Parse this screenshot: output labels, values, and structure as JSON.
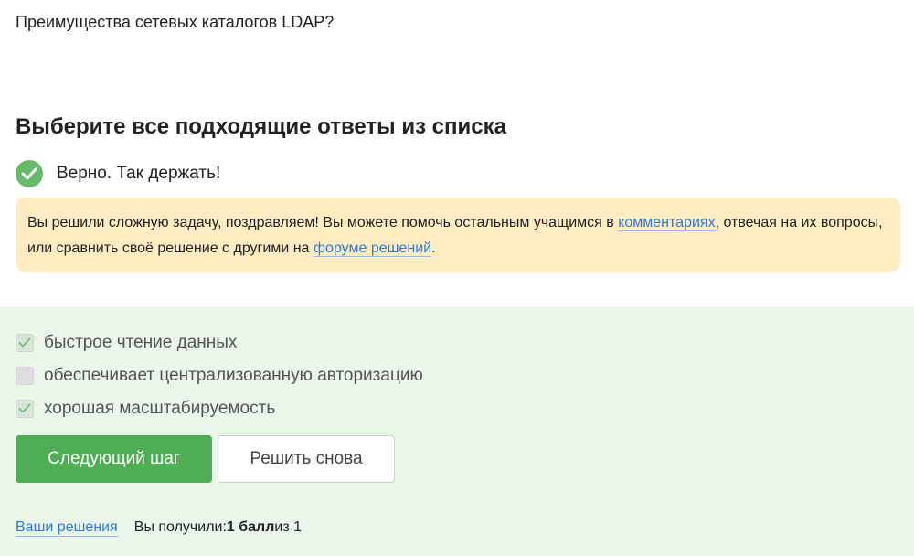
{
  "question": {
    "text": "Преимущества сетевых каталогов LDAP?"
  },
  "instruction": {
    "text": "Выберите все подходящие ответы из списка"
  },
  "status": {
    "icon": "check-circle-icon",
    "text": "Верно. Так держать!",
    "color": "#66bb6a"
  },
  "notice": {
    "part1": "Вы решили сложную задачу, поздравляем! Вы можете помочь остальным учащимся в ",
    "link1": "комментариях",
    "part2": ", отвечая на их вопросы, или сравнить своё решение с другими на ",
    "link2": "форуме решений",
    "part3": ".",
    "background": "#feecc2"
  },
  "options": [
    {
      "label": "быстрое чтение данных",
      "checked": true
    },
    {
      "label": "обеспечивает централизованную авторизацию",
      "checked": false
    },
    {
      "label": "хорошая масштабируемость",
      "checked": true
    }
  ],
  "buttons": {
    "next_label": "Следующий шаг",
    "retry_label": "Решить снова"
  },
  "footer": {
    "solutions_link": "Ваши решения",
    "score_prefix": "Вы получили: ",
    "score_value": "1 балл",
    "score_suffix": " из 1"
  },
  "colors": {
    "accent_green": "#4fae55",
    "answer_background": "#e9f6e9",
    "link": "#2e7bd6"
  }
}
